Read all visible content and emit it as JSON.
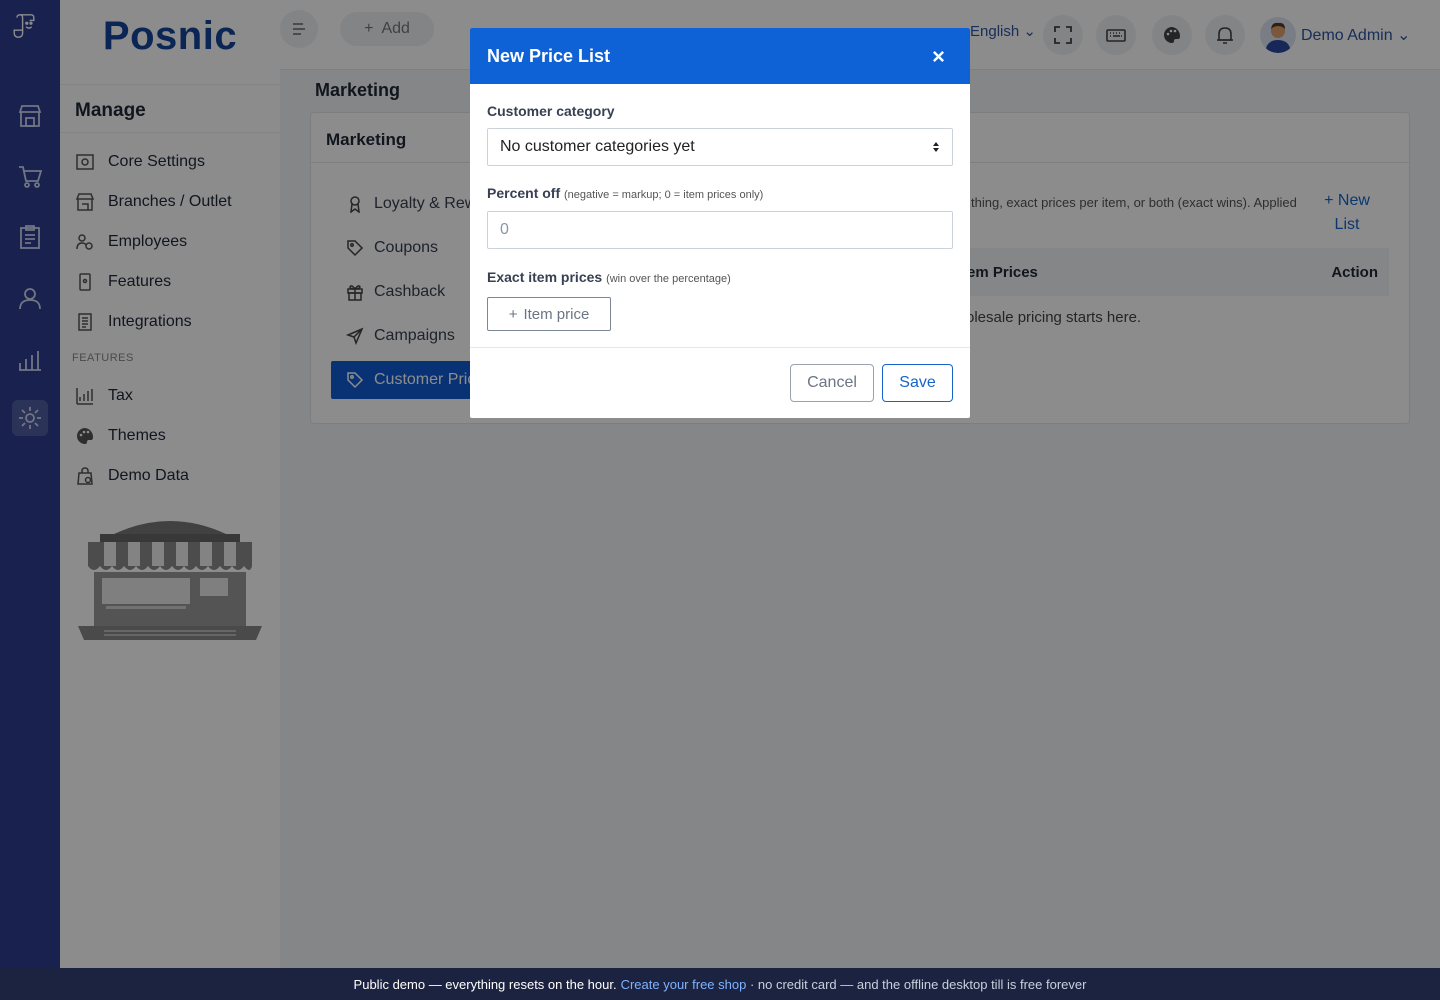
{
  "brand": "Posnic",
  "sidebar": {
    "section_title": "Manage",
    "items": [
      {
        "label": "Core Settings",
        "icon": "settings-sliders-icon"
      },
      {
        "label": "Branches / Outlet",
        "icon": "store-icon"
      },
      {
        "label": "Employees",
        "icon": "employees-icon"
      },
      {
        "label": "Features",
        "icon": "mobile-icon"
      },
      {
        "label": "Integrations",
        "icon": "document-icon"
      }
    ],
    "features_label": "FEATURES",
    "feature_items": [
      {
        "label": "Tax",
        "icon": "chart-icon"
      },
      {
        "label": "Themes",
        "icon": "palette-icon"
      },
      {
        "label": "Demo Data",
        "icon": "bag-icon"
      }
    ]
  },
  "topbar": {
    "add_label": "Add",
    "language": "English",
    "user_name": "Demo Admin"
  },
  "content": {
    "page_title": "Marketing",
    "card_title": "Marketing",
    "sub_menu": [
      {
        "label": "Loyalty & Rew",
        "icon": "award-icon"
      },
      {
        "label": "Coupons",
        "icon": "tag-icon"
      },
      {
        "label": "Cashback",
        "icon": "gift-icon"
      },
      {
        "label": "Campaigns",
        "icon": "send-icon"
      },
      {
        "label": "Customer Pric",
        "icon": "tag-icon",
        "active": true
      }
    ],
    "description": "thing, exact prices per item, or both (exact wins). Applied",
    "new_list_label": "New List",
    "table_headers": {
      "prices": "em Prices",
      "action": "Action"
    },
    "empty_message": "olesale pricing starts here."
  },
  "modal": {
    "title": "New Price List",
    "customer_category_label": "Customer category",
    "customer_category_value": "No customer categories yet",
    "percent_off_label": "Percent off",
    "percent_off_hint": "(negative = markup; 0 = item prices only)",
    "percent_off_placeholder": "0",
    "exact_prices_label": "Exact item prices",
    "exact_prices_hint": "(win over the percentage)",
    "item_price_button": "Item price",
    "cancel_label": "Cancel",
    "save_label": "Save"
  },
  "footer": {
    "prefix": "Public demo — everything resets on the hour.",
    "link": "Create your free shop",
    "suffix": "· no credit card — and the offline desktop till is free forever"
  },
  "colors": {
    "rail": "#2e3f8f",
    "brand": "#14459a",
    "modal_header": "#0f62d6",
    "active_item": "#0f5bd1",
    "footer": "#1c2340"
  }
}
